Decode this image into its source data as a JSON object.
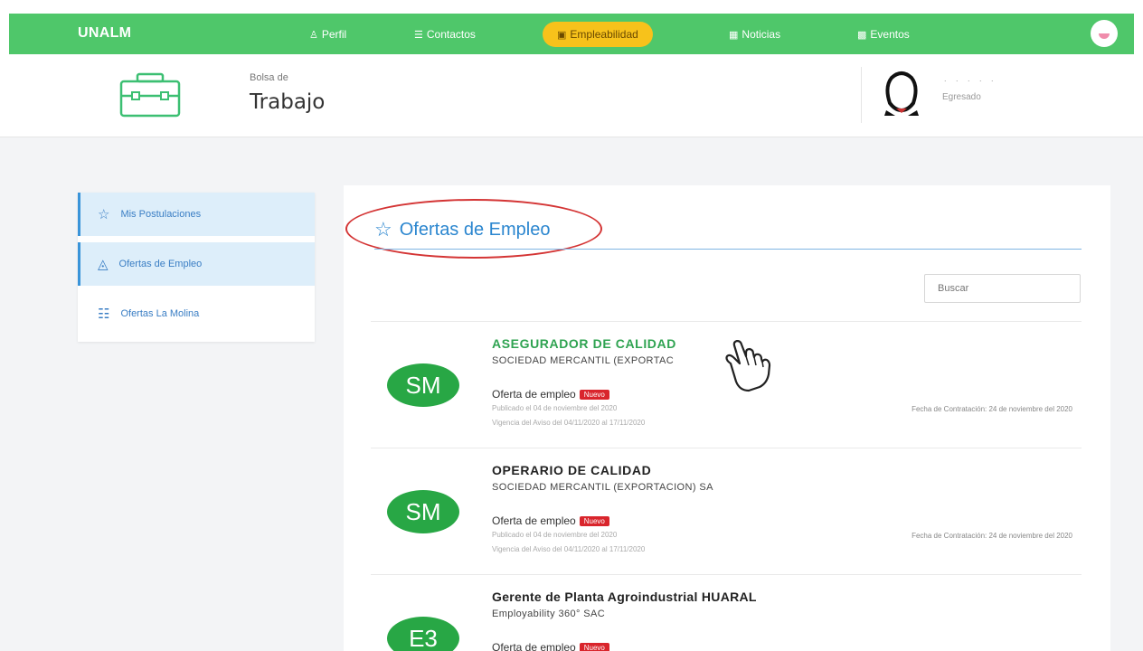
{
  "nav": {
    "brand": "UNALM",
    "items": [
      {
        "label": "Perfil",
        "icon": "user-icon"
      },
      {
        "label": "Contactos",
        "icon": "contacts-icon"
      },
      {
        "label": "Empleabilidad",
        "icon": "briefcase-icon",
        "active": true
      },
      {
        "label": "Noticias",
        "icon": "newspaper-icon"
      },
      {
        "label": "Eventos",
        "icon": "calendar-icon"
      }
    ]
  },
  "header": {
    "subtitle": "Bolsa de",
    "title": "Trabajo",
    "user_name": ". . . . .",
    "user_role": "Egresado"
  },
  "sidebar": {
    "items": [
      {
        "label": "Mis Postulaciones",
        "icon": "star-icon"
      },
      {
        "label": "Ofertas de Empleo",
        "icon": "factory-icon"
      },
      {
        "label": "Ofertas La Molina",
        "icon": "institution-icon"
      }
    ]
  },
  "main": {
    "title": "Ofertas de Empleo",
    "search_placeholder": "Buscar",
    "jobs": [
      {
        "logo": "SM",
        "title": "ASEGURADOR DE CALIDAD",
        "company": "SOCIEDAD MERCANTIL (EXPORTAC",
        "type": "Oferta de empleo",
        "badge": "Nuevo",
        "published": "Publicado el 04 de noviembre del 2020",
        "validity": "Vigencia del Aviso del 04/11/2020 al 17/11/2020",
        "hire_date": "Fecha de Contratación: 24 de noviembre del 2020"
      },
      {
        "logo": "SM",
        "title": "OPERARIO DE CALIDAD",
        "company": "SOCIEDAD MERCANTIL (EXPORTACION) SA",
        "type": "Oferta de empleo",
        "badge": "Nuevo",
        "published": "Publicado el 04 de noviembre del 2020",
        "validity": "Vigencia del Aviso del 04/11/2020 al 17/11/2020",
        "hire_date": "Fecha de Contratación: 24 de noviembre del 2020"
      },
      {
        "logo": "E3",
        "title": "Gerente de Planta Agroindustrial HUARAL",
        "company": "Employability 360° SAC",
        "type": "Oferta de empleo",
        "badge": "Nuevo"
      }
    ]
  },
  "colors": {
    "nav_green": "#4fc76a",
    "active_yellow": "#f7c21b",
    "accent_blue": "#2b86cf",
    "logo_green": "#28a745",
    "badge_red": "#d9252c",
    "highlight_ellipse": "#d43535"
  }
}
